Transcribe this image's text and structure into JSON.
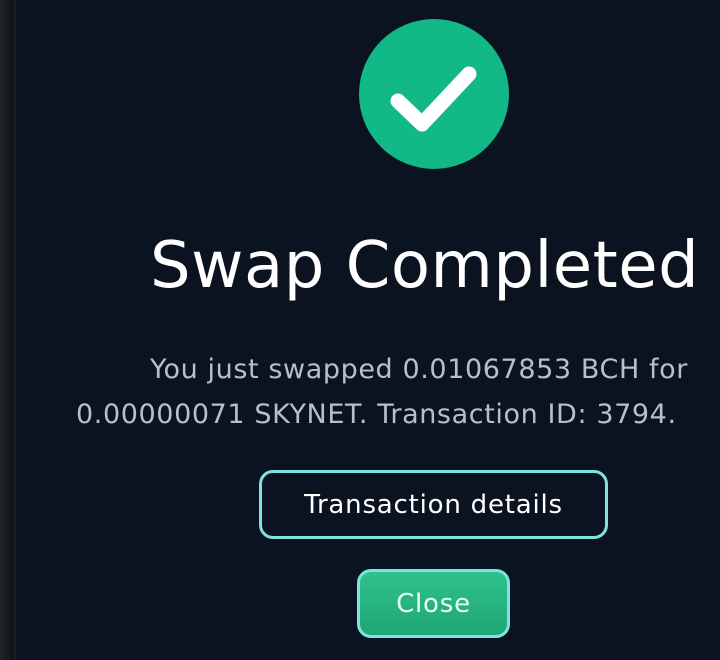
{
  "dialog": {
    "title": "Swap Completed",
    "message_line1": "You just swapped 0.01067853 BCH for",
    "message_line2": "0.00000071 SKYNET. Transaction ID: 3794.",
    "status_icon": "checkmark-icon",
    "accent_color": "#12b886",
    "button_border_color": "#7fe3dd",
    "background_color": "#0c1320"
  },
  "actions": {
    "details_label": "Transaction details",
    "close_label": "Close"
  }
}
